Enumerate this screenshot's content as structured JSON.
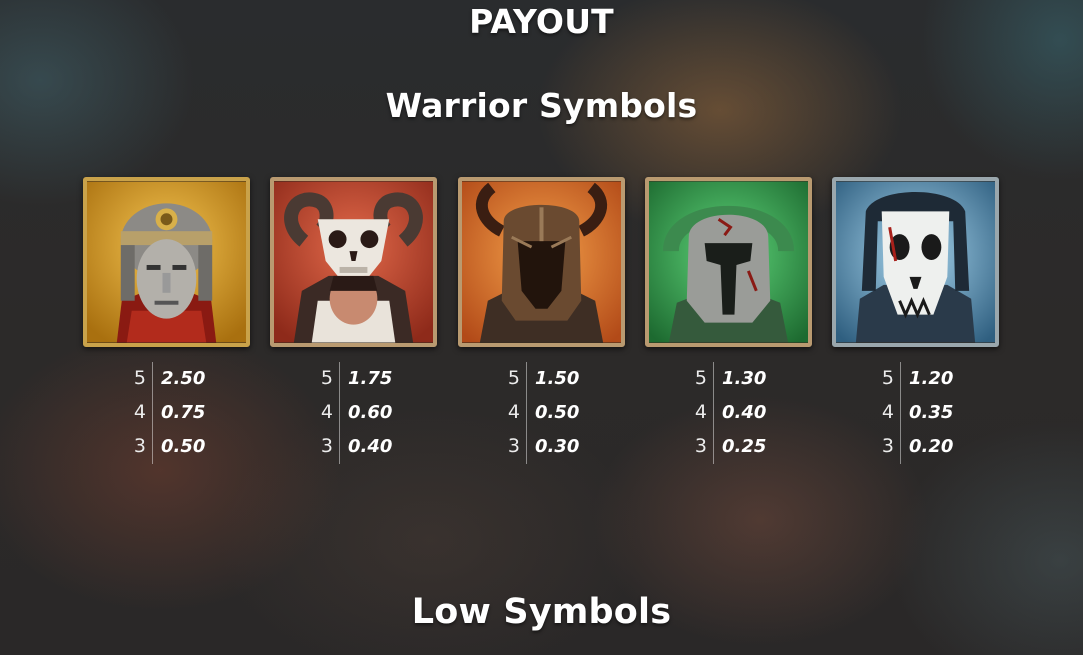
{
  "header": {
    "title": "PAYOUT"
  },
  "sections": {
    "warrior_title": "Warrior Symbols",
    "low_title": "Low Symbols"
  },
  "warrior_symbols": [
    {
      "icon": "roman-legionary-icon",
      "payouts": [
        {
          "count": "5",
          "value": "2.50"
        },
        {
          "count": "4",
          "value": "0.75"
        },
        {
          "count": "3",
          "value": "0.50"
        }
      ]
    },
    {
      "icon": "ram-skull-warrior-icon",
      "payouts": [
        {
          "count": "5",
          "value": "1.75"
        },
        {
          "count": "4",
          "value": "0.60"
        },
        {
          "count": "3",
          "value": "0.40"
        }
      ]
    },
    {
      "icon": "horned-helmet-icon",
      "payouts": [
        {
          "count": "5",
          "value": "1.50"
        },
        {
          "count": "4",
          "value": "0.50"
        },
        {
          "count": "3",
          "value": "0.30"
        }
      ]
    },
    {
      "icon": "spartan-helmet-icon",
      "payouts": [
        {
          "count": "5",
          "value": "1.30"
        },
        {
          "count": "4",
          "value": "0.40"
        },
        {
          "count": "3",
          "value": "0.25"
        }
      ]
    },
    {
      "icon": "wolf-skull-warrior-icon",
      "payouts": [
        {
          "count": "5",
          "value": "1.20"
        },
        {
          "count": "4",
          "value": "0.35"
        },
        {
          "count": "3",
          "value": "0.20"
        }
      ]
    }
  ]
}
